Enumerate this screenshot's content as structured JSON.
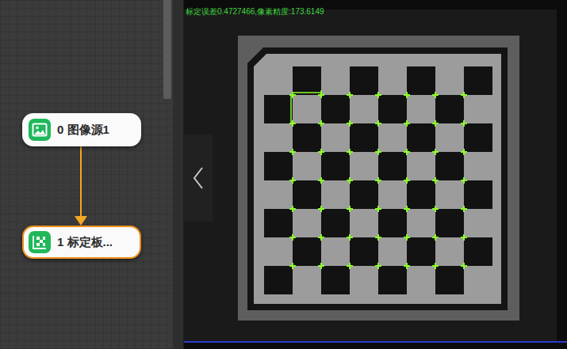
{
  "canvas": {
    "nodes": [
      {
        "label": "0 图像源1",
        "kind": "image-source",
        "selected": false
      },
      {
        "label": "1 标定板...",
        "kind": "calibration",
        "selected": true
      }
    ],
    "links": [
      {
        "from": 0,
        "to": 1
      }
    ]
  },
  "viewer": {
    "status_text": "标定误差0.4727466,像素精度:173.6149",
    "corner_grid": {
      "rows": 7,
      "cols": 7
    }
  }
}
